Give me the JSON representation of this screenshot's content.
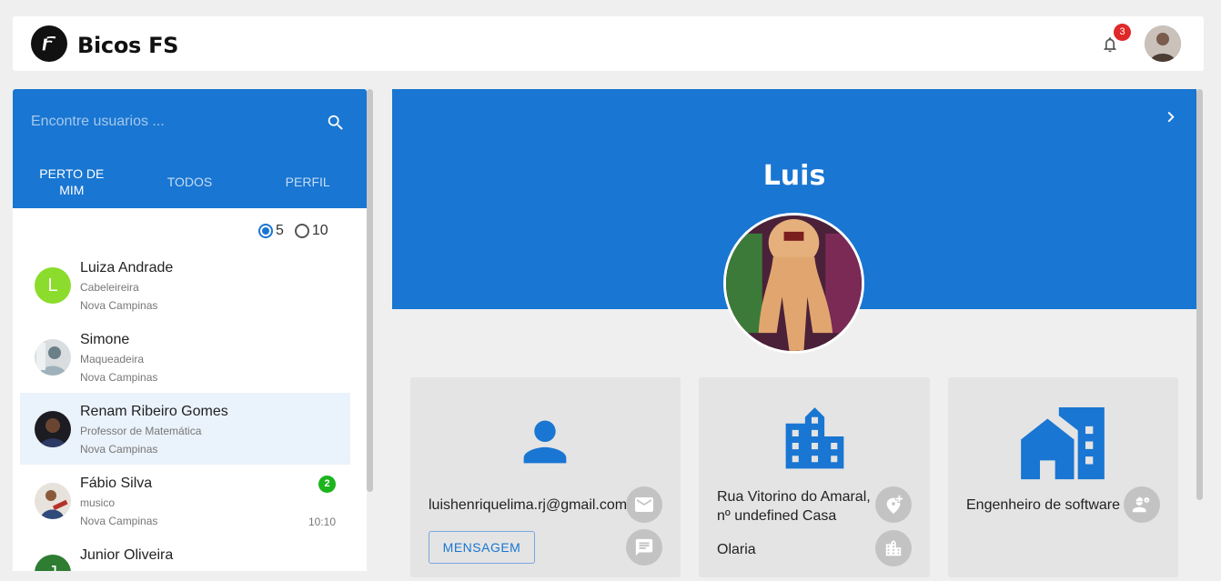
{
  "header": {
    "brand": "Bicos FS",
    "notification_count": "3"
  },
  "search": {
    "placeholder": "Encontre usuarios ..."
  },
  "tabs": [
    {
      "label": "PERTO DE MIM",
      "active": true
    },
    {
      "label": "TODOS",
      "active": false
    },
    {
      "label": "PERFIL",
      "active": false
    }
  ],
  "radius_options": [
    {
      "label": "5",
      "selected": true
    },
    {
      "label": "10",
      "selected": false
    }
  ],
  "users": [
    {
      "name": "Luiza Andrade",
      "role": "Cabeleireira",
      "city": "Nova Campinas",
      "avatar_letter": "L",
      "unread": "",
      "time": ""
    },
    {
      "name": "Simone",
      "role": "Maqueadeira",
      "city": "Nova Campinas",
      "avatar_letter": "",
      "unread": "",
      "time": ""
    },
    {
      "name": "Renam Ribeiro Gomes",
      "role": "Professor de Matemática",
      "city": "Nova Campinas",
      "avatar_letter": "",
      "unread": "",
      "time": ""
    },
    {
      "name": "Fábio Silva",
      "role": "musico",
      "city": "Nova Campinas",
      "avatar_letter": "",
      "unread": "2",
      "time": "10:10"
    },
    {
      "name": "Junior Oliveira",
      "role": "",
      "city": "",
      "avatar_letter": "J",
      "unread": "",
      "time": ""
    }
  ],
  "profile": {
    "name": "Luis",
    "email": "luishenriquelima.rj@gmail.com",
    "message_button": "MENSAGEM",
    "address_line": "Rua Vitorino do Amaral, nº undefined Casa",
    "neighborhood": "Olaria",
    "occupation": "Engenheiro de software"
  },
  "colors": {
    "primary": "#1976d2",
    "badge_red": "#e02828",
    "badge_green": "#1cb41c",
    "selected_row": "#eaf2fb"
  }
}
